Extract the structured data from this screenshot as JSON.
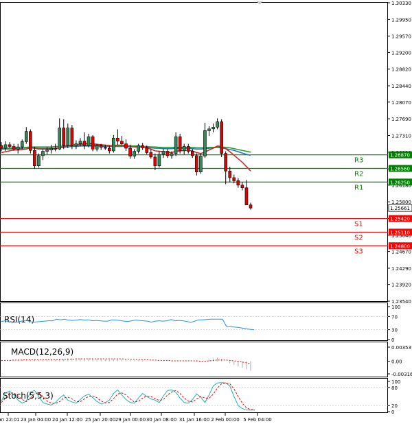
{
  "chart_data": {
    "type": "candlestick",
    "price_panel": {
      "ylim": [
        1.2354,
        1.3033
      ],
      "y_ticks": [
        "1.30330",
        "1.29950",
        "1.29570",
        "1.29200",
        "1.28820",
        "1.28440",
        "1.28070",
        "1.27690",
        "1.27310",
        "1.26930",
        "1.26550",
        "1.26180",
        "1.25800",
        "1.25420",
        "1.25040",
        "1.24670",
        "1.24290",
        "1.23920",
        "1.23540"
      ],
      "last_price": "1.25661",
      "candles": [
        {
          "o": 1.2708,
          "h": 1.2716,
          "l": 1.2695,
          "c": 1.2702
        },
        {
          "o": 1.2702,
          "h": 1.2718,
          "l": 1.2696,
          "c": 1.271
        },
        {
          "o": 1.271,
          "h": 1.2716,
          "l": 1.2702,
          "c": 1.2706
        },
        {
          "o": 1.2706,
          "h": 1.2712,
          "l": 1.2696,
          "c": 1.27
        },
        {
          "o": 1.27,
          "h": 1.2712,
          "l": 1.269,
          "c": 1.2705
        },
        {
          "o": 1.2705,
          "h": 1.2722,
          "l": 1.27,
          "c": 1.2717
        },
        {
          "o": 1.2717,
          "h": 1.275,
          "l": 1.2712,
          "c": 1.274
        },
        {
          "o": 1.274,
          "h": 1.2745,
          "l": 1.269,
          "c": 1.2697
        },
        {
          "o": 1.2697,
          "h": 1.2705,
          "l": 1.2655,
          "c": 1.2662
        },
        {
          "o": 1.2662,
          "h": 1.269,
          "l": 1.2658,
          "c": 1.2685
        },
        {
          "o": 1.2685,
          "h": 1.27,
          "l": 1.2675,
          "c": 1.2695
        },
        {
          "o": 1.2695,
          "h": 1.2705,
          "l": 1.2688,
          "c": 1.2698
        },
        {
          "o": 1.2698,
          "h": 1.271,
          "l": 1.269,
          "c": 1.2702
        },
        {
          "o": 1.2702,
          "h": 1.2712,
          "l": 1.2695,
          "c": 1.27
        },
        {
          "o": 1.27,
          "h": 1.277,
          "l": 1.2698,
          "c": 1.2748
        },
        {
          "o": 1.2748,
          "h": 1.2768,
          "l": 1.27,
          "c": 1.2708
        },
        {
          "o": 1.2708,
          "h": 1.2758,
          "l": 1.2702,
          "c": 1.2748
        },
        {
          "o": 1.2748,
          "h": 1.2755,
          "l": 1.27,
          "c": 1.2708
        },
        {
          "o": 1.2708,
          "h": 1.272,
          "l": 1.27,
          "c": 1.2712
        },
        {
          "o": 1.2712,
          "h": 1.2725,
          "l": 1.2706,
          "c": 1.2718
        },
        {
          "o": 1.2718,
          "h": 1.2738,
          "l": 1.27,
          "c": 1.2708
        },
        {
          "o": 1.2708,
          "h": 1.2735,
          "l": 1.2704,
          "c": 1.2728
        },
        {
          "o": 1.2728,
          "h": 1.2732,
          "l": 1.2695,
          "c": 1.27
        },
        {
          "o": 1.27,
          "h": 1.2712,
          "l": 1.2695,
          "c": 1.2708
        },
        {
          "o": 1.2708,
          "h": 1.2712,
          "l": 1.2698,
          "c": 1.2704
        },
        {
          "o": 1.2704,
          "h": 1.271,
          "l": 1.2698,
          "c": 1.2702
        },
        {
          "o": 1.2702,
          "h": 1.2708,
          "l": 1.269,
          "c": 1.2696
        },
        {
          "o": 1.2696,
          "h": 1.2732,
          "l": 1.2692,
          "c": 1.2725
        },
        {
          "o": 1.2725,
          "h": 1.2745,
          "l": 1.271,
          "c": 1.2718
        },
        {
          "o": 1.2718,
          "h": 1.273,
          "l": 1.271,
          "c": 1.2712
        },
        {
          "o": 1.2712,
          "h": 1.2722,
          "l": 1.2696,
          "c": 1.2702
        },
        {
          "o": 1.2702,
          "h": 1.271,
          "l": 1.2678,
          "c": 1.2684
        },
        {
          "o": 1.2684,
          "h": 1.27,
          "l": 1.2678,
          "c": 1.2695
        },
        {
          "o": 1.2695,
          "h": 1.2712,
          "l": 1.269,
          "c": 1.2708
        },
        {
          "o": 1.2708,
          "h": 1.2714,
          "l": 1.2698,
          "c": 1.2703
        },
        {
          "o": 1.2703,
          "h": 1.2708,
          "l": 1.2688,
          "c": 1.2692
        },
        {
          "o": 1.2692,
          "h": 1.27,
          "l": 1.2678,
          "c": 1.2682
        },
        {
          "o": 1.2682,
          "h": 1.269,
          "l": 1.2652,
          "c": 1.2662
        },
        {
          "o": 1.2662,
          "h": 1.2695,
          "l": 1.2658,
          "c": 1.2688
        },
        {
          "o": 1.2688,
          "h": 1.27,
          "l": 1.268,
          "c": 1.2695
        },
        {
          "o": 1.2695,
          "h": 1.27,
          "l": 1.268,
          "c": 1.2685
        },
        {
          "o": 1.2685,
          "h": 1.2695,
          "l": 1.2678,
          "c": 1.269
        },
        {
          "o": 1.269,
          "h": 1.2738,
          "l": 1.2684,
          "c": 1.2728
        },
        {
          "o": 1.2728,
          "h": 1.2735,
          "l": 1.269,
          "c": 1.2696
        },
        {
          "o": 1.2696,
          "h": 1.2712,
          "l": 1.2688,
          "c": 1.2706
        },
        {
          "o": 1.2706,
          "h": 1.2712,
          "l": 1.269,
          "c": 1.2695
        },
        {
          "o": 1.2695,
          "h": 1.27,
          "l": 1.268,
          "c": 1.2685
        },
        {
          "o": 1.2685,
          "h": 1.269,
          "l": 1.264,
          "c": 1.2648
        },
        {
          "o": 1.2648,
          "h": 1.269,
          "l": 1.2644,
          "c": 1.2684
        },
        {
          "o": 1.2684,
          "h": 1.276,
          "l": 1.268,
          "c": 1.2742
        },
        {
          "o": 1.2742,
          "h": 1.2752,
          "l": 1.273,
          "c": 1.2746
        },
        {
          "o": 1.2746,
          "h": 1.2758,
          "l": 1.2738,
          "c": 1.275
        },
        {
          "o": 1.275,
          "h": 1.277,
          "l": 1.2745,
          "c": 1.2762
        },
        {
          "o": 1.2762,
          "h": 1.2768,
          "l": 1.2682,
          "c": 1.269
        },
        {
          "o": 1.269,
          "h": 1.2695,
          "l": 1.262,
          "c": 1.265
        },
        {
          "o": 1.265,
          "h": 1.266,
          "l": 1.2624,
          "c": 1.2635
        },
        {
          "o": 1.2635,
          "h": 1.2642,
          "l": 1.2622,
          "c": 1.2628
        },
        {
          "o": 1.2628,
          "h": 1.2634,
          "l": 1.2612,
          "c": 1.2618
        },
        {
          "o": 1.2618,
          "h": 1.2625,
          "l": 1.2606,
          "c": 1.2612
        },
        {
          "o": 1.2612,
          "h": 1.263,
          "l": 1.258,
          "c": 1.2573
        },
        {
          "o": 1.2573,
          "h": 1.2578,
          "l": 1.2562,
          "c": 1.2566
        }
      ],
      "moving_averages": [
        {
          "color": "#1f77b4",
          "values": [
            1.27,
            1.27,
            1.27,
            1.2701,
            1.2701,
            1.2702,
            1.2703,
            1.2704,
            1.2703,
            1.2702,
            1.2702,
            1.2702,
            1.2702,
            1.2702,
            1.2703,
            1.2704,
            1.2705,
            1.2706,
            1.2706,
            1.2707,
            1.2707,
            1.2707,
            1.2707,
            1.2707,
            1.2707,
            1.2706,
            1.2706,
            1.2706,
            1.2706,
            1.2706,
            1.2706,
            1.2705,
            1.2705,
            1.2705,
            1.2704,
            1.2704,
            1.2703,
            1.2702,
            1.2702,
            1.2701,
            1.2701,
            1.2701,
            1.2702,
            1.2702,
            1.2702,
            1.2702,
            1.2701,
            1.27,
            1.27,
            1.2701,
            1.2702,
            1.2703,
            1.2704,
            1.2703,
            1.2701,
            1.2699,
            1.2697,
            1.2694,
            1.2691,
            1.2688,
            1.2686
          ]
        },
        {
          "color": "#2ca02c",
          "values": [
            1.2702,
            1.2702,
            1.2702,
            1.2703,
            1.2703,
            1.2703,
            1.2704,
            1.2705,
            1.2705,
            1.2705,
            1.2705,
            1.2705,
            1.2705,
            1.2706,
            1.2706,
            1.2707,
            1.2708,
            1.2708,
            1.2709,
            1.2709,
            1.2709,
            1.2709,
            1.2709,
            1.2709,
            1.2709,
            1.2709,
            1.2708,
            1.2708,
            1.2708,
            1.2708,
            1.2708,
            1.2707,
            1.2707,
            1.2707,
            1.2706,
            1.2706,
            1.2705,
            1.2705,
            1.2704,
            1.2704,
            1.2704,
            1.2704,
            1.2704,
            1.2704,
            1.2704,
            1.2704,
            1.2704,
            1.2703,
            1.2703,
            1.2703,
            1.2704,
            1.2704,
            1.2705,
            1.2705,
            1.2704,
            1.2703,
            1.2701,
            1.2699,
            1.2697,
            1.2695,
            1.2693
          ]
        },
        {
          "color": "#d62728",
          "values": [
            1.2692,
            1.2694,
            1.2696,
            1.2698,
            1.2698,
            1.2699,
            1.27,
            1.2703,
            1.2702,
            1.27,
            1.27,
            1.27,
            1.27,
            1.27,
            1.2704,
            1.2705,
            1.2708,
            1.2709,
            1.271,
            1.2711,
            1.2712,
            1.2713,
            1.2712,
            1.2711,
            1.271,
            1.2709,
            1.2707,
            1.2708,
            1.2709,
            1.2709,
            1.2708,
            1.2706,
            1.2705,
            1.2705,
            1.2705,
            1.2703,
            1.27,
            1.2696,
            1.2695,
            1.2694,
            1.2693,
            1.2692,
            1.2695,
            1.2696,
            1.2697,
            1.2697,
            1.2696,
            1.2692,
            1.269,
            1.2693,
            1.2698,
            1.2702,
            1.2707,
            1.2706,
            1.2701,
            1.2694,
            1.2686,
            1.2678,
            1.267,
            1.266,
            1.265
          ]
        }
      ]
    },
    "levels": [
      {
        "label": "R3",
        "value": 1.2687,
        "value_label": "1.26870",
        "color": "#008000"
      },
      {
        "label": "R2",
        "value": 1.2656,
        "value_label": "1.26560",
        "color": "#008000"
      },
      {
        "label": "R1",
        "value": 1.2625,
        "value_label": "1.26250",
        "color": "#008000"
      },
      {
        "label": "S1",
        "value": 1.2542,
        "value_label": "1.25420",
        "color": "#ff0000"
      },
      {
        "label": "S2",
        "value": 1.2511,
        "value_label": "1.25110",
        "color": "#ff0000"
      },
      {
        "label": "S3",
        "value": 1.248,
        "value_label": "1.24800",
        "color": "#ff0000"
      }
    ],
    "rsi": {
      "label": "RSI(14)",
      "ylim": [
        0,
        100
      ],
      "y_ticks": [
        "100",
        "70",
        "30",
        "0"
      ],
      "color": "#1e90ff",
      "values": [
        55,
        57,
        54,
        52,
        53,
        56,
        58,
        56,
        52,
        54,
        55,
        56,
        57,
        57,
        62,
        60,
        62,
        59,
        58,
        59,
        61,
        59,
        60,
        57,
        58,
        57,
        56,
        56,
        60,
        59,
        58,
        56,
        55,
        57,
        59,
        58,
        57,
        56,
        53,
        56,
        57,
        56,
        57,
        61,
        57,
        58,
        57,
        55,
        52,
        56,
        60,
        60,
        61,
        62,
        62,
        62,
        62,
        40,
        40,
        38,
        37,
        35,
        33,
        31,
        30
      ]
    },
    "macd": {
      "label": "MACD(12,26,9)",
      "ylim": [
        -0.003165,
        0.003537
      ],
      "y_ticks": [
        "0.003537",
        "0.00",
        "-0.003165"
      ],
      "histogram": [
        0.0002,
        0.0002,
        0.0003,
        0.0003,
        0.0003,
        0.0004,
        0.0005,
        0.0004,
        0.0003,
        0.0003,
        0.0003,
        0.0004,
        0.0004,
        0.0004,
        0.0006,
        0.0006,
        0.0007,
        0.0007,
        0.0007,
        0.0007,
        0.0007,
        0.0007,
        0.0006,
        0.0006,
        0.0005,
        0.0005,
        0.0004,
        0.0005,
        0.0005,
        0.0005,
        0.0004,
        0.0003,
        0.0002,
        0.0002,
        0.0002,
        0.0001,
        0.0,
        -0.0001,
        -0.0001,
        -0.0001,
        -0.0001,
        -0.0001,
        0.0001,
        0.0001,
        0.0001,
        0.0001,
        0.0,
        -0.0002,
        -0.0002,
        0.0001,
        0.0004,
        0.0007,
        0.0009,
        0.0006,
        0.0,
        -0.0005,
        -0.0009,
        -0.0013,
        -0.0016,
        -0.002,
        -0.0024
      ],
      "signal": [
        0.0002,
        0.0002,
        0.0002,
        0.0003,
        0.0003,
        0.0003,
        0.0004,
        0.0004,
        0.0004,
        0.0004,
        0.0004,
        0.0004,
        0.0004,
        0.0004,
        0.0004,
        0.0005,
        0.0005,
        0.0005,
        0.0006,
        0.0006,
        0.0006,
        0.0006,
        0.0006,
        0.0006,
        0.0006,
        0.0006,
        0.0006,
        0.0006,
        0.0006,
        0.0006,
        0.0005,
        0.0005,
        0.0005,
        0.0004,
        0.0004,
        0.0004,
        0.0003,
        0.0003,
        0.0002,
        0.0002,
        0.0002,
        0.0001,
        0.0001,
        0.0001,
        0.0001,
        0.0001,
        0.0001,
        0.0001,
        0.0,
        0.0,
        0.0001,
        0.0002,
        0.0003,
        0.0003,
        0.0003,
        0.0002,
        0.0001,
        0.0,
        -0.0002,
        -0.0004,
        -0.0006
      ],
      "signal_color": "#ff0000",
      "histogram_color": "#a9a9a9"
    },
    "stoch": {
      "label": "Stoch(5,5,3)",
      "ylim": [
        0,
        100
      ],
      "y_ticks": [
        "100",
        "80",
        "20",
        "0"
      ],
      "main_color": "#20b2aa",
      "signal_color": "#ff0000",
      "main": [
        35,
        62,
        68,
        55,
        38,
        28,
        35,
        65,
        70,
        50,
        30,
        25,
        22,
        30,
        45,
        55,
        38,
        32,
        28,
        40,
        52,
        58,
        46,
        34,
        25,
        30,
        38,
        60,
        72,
        55,
        40,
        30,
        28,
        45,
        60,
        50,
        42,
        38,
        30,
        52,
        70,
        72,
        64,
        45,
        30,
        28,
        40,
        58,
        48,
        30,
        55,
        85,
        95,
        96,
        95,
        85,
        50,
        20,
        10,
        5,
        5,
        5
      ],
      "signal": [
        30,
        45,
        60,
        62,
        52,
        40,
        33,
        45,
        60,
        62,
        50,
        35,
        28,
        27,
        33,
        45,
        48,
        42,
        33,
        33,
        42,
        50,
        52,
        46,
        35,
        29,
        30,
        43,
        58,
        62,
        55,
        42,
        32,
        34,
        45,
        52,
        50,
        43,
        37,
        40,
        55,
        65,
        70,
        60,
        45,
        35,
        32,
        42,
        50,
        45,
        44,
        58,
        78,
        92,
        95,
        92,
        75,
        50,
        28,
        12,
        7,
        6
      ]
    },
    "x_ticks": [
      "Jan 22:01",
      "23 Jan 04:00",
      "24 Jan 12:00",
      "25 Jan 20:00",
      "29 Jan 00:00",
      "30 Jan 08:00",
      "31 Jan 16:00",
      "2 Feb 00:00",
      "5 Feb 04:00"
    ]
  }
}
